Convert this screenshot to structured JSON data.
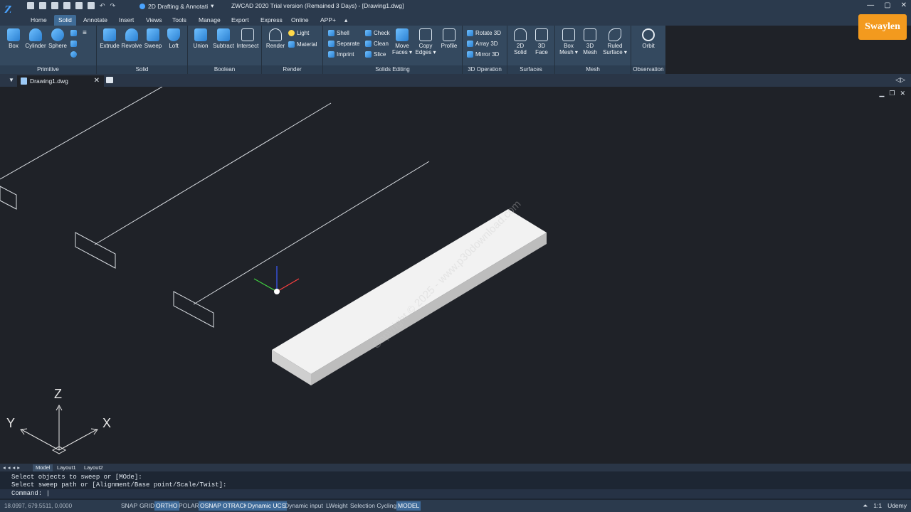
{
  "titlebar": {
    "workspace": "2D Drafting & Annotati",
    "title": "ZWCAD 2020 Trial version (Remained 3 Days) - [Drawing1.dwg]"
  },
  "menu_tabs": [
    "Home",
    "Solid",
    "Annotate",
    "Insert",
    "Views",
    "Tools",
    "Manage",
    "Export",
    "Express",
    "Online",
    "APP+"
  ],
  "active_tab": "Solid",
  "ribbon": {
    "primitive": {
      "title": "Primitive",
      "tools": [
        "Box",
        "Cylinder",
        "Sphere"
      ]
    },
    "solid": {
      "title": "Solid",
      "tools": [
        "Extrude",
        "Revolve",
        "Sweep",
        "Loft"
      ]
    },
    "boolean": {
      "title": "Boolean",
      "tools": [
        "Union",
        "Subtract",
        "Intersect"
      ]
    },
    "render": {
      "title": "Render",
      "tool": "Render",
      "small": [
        "Light",
        "Material"
      ]
    },
    "solids_editing": {
      "title": "Solids Editing",
      "small_left": [
        "Shell",
        "Separate",
        "Imprint"
      ],
      "small_right": [
        "Check",
        "Clean",
        "Slice"
      ],
      "move_faces": [
        "Move",
        "Faces ▾"
      ],
      "copy_edges": [
        "Copy",
        "Edges ▾"
      ],
      "profile": "Profile"
    },
    "op3d": {
      "title": "3D Operation",
      "small": [
        "Rotate 3D",
        "Array 3D",
        "Mirror 3D"
      ]
    },
    "surfaces": {
      "title": "Surfaces",
      "tools": [
        [
          "2D",
          "Solid"
        ],
        [
          "3D",
          "Face"
        ]
      ]
    },
    "mesh": {
      "title": "Mesh",
      "tools": [
        [
          "Box",
          "Mesh ▾"
        ],
        [
          "3D",
          "Mesh"
        ],
        [
          "Ruled",
          "Surface ▾"
        ]
      ]
    },
    "observation": {
      "title": "Observation",
      "tool": "Orbit"
    }
  },
  "brand": "Swaylen",
  "doc_tab": "Drawing1.dwg",
  "watermark": "Copyright © 2025 - www.p30download.com",
  "axes": {
    "x": "X",
    "y": "Y",
    "z": "Z"
  },
  "layout_tabs": [
    "Model",
    "Layout1",
    "Layout2"
  ],
  "command": {
    "history": [
      "Select objects to sweep or [MOde]:",
      "Select sweep path or [Alignment/Base point/Scale/Twist]:"
    ],
    "prompt": "Command:"
  },
  "status": {
    "coords": "18.0997, 679.5511, 0.0000",
    "toggles": [
      {
        "label": "SNAP",
        "on": false
      },
      {
        "label": "GRID",
        "on": false
      },
      {
        "label": "ORTHO",
        "on": true
      },
      {
        "label": "POLAR",
        "on": false
      },
      {
        "label": "OSNAP",
        "on": true
      },
      {
        "label": "OTRACK",
        "on": true
      },
      {
        "label": "Dynamic UCS",
        "on": true
      },
      {
        "label": "Dynamic input",
        "on": false
      },
      {
        "label": "LWeight",
        "on": false
      },
      {
        "label": "Selection Cycling",
        "on": false
      },
      {
        "label": "MODEL",
        "on": true
      }
    ],
    "scale": "1:1",
    "udemy": "Udemy"
  }
}
